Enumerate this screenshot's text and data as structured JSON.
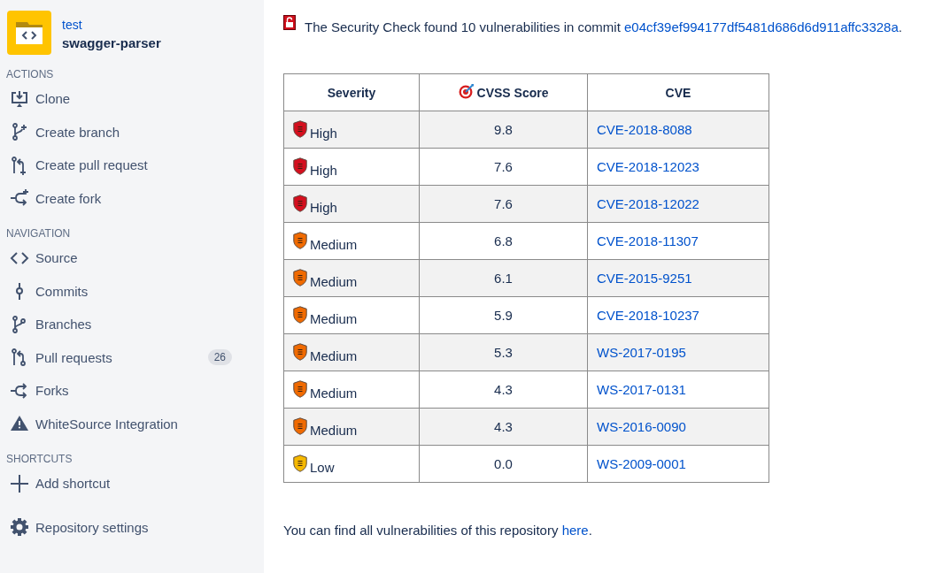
{
  "sidebar": {
    "repository": {
      "workspace": "test",
      "name": "swagger-parser"
    },
    "sections": [
      {
        "heading": "ACTIONS",
        "items": [
          {
            "label": "Clone"
          },
          {
            "label": "Create branch"
          },
          {
            "label": "Create pull request"
          },
          {
            "label": "Create fork"
          }
        ]
      },
      {
        "heading": "NAVIGATION",
        "items": [
          {
            "label": "Source"
          },
          {
            "label": "Commits"
          },
          {
            "label": "Branches"
          },
          {
            "label": "Pull requests",
            "badge": "26"
          },
          {
            "label": "Forks"
          },
          {
            "label": "WhiteSource Integration"
          }
        ]
      },
      {
        "heading": "SHORTCUTS",
        "items": [
          {
            "label": "Add shortcut"
          }
        ]
      }
    ],
    "settings": "Repository settings"
  },
  "summary": {
    "text": "The Security Check found 10 vulnerabilities in commit ",
    "commit": "e04cf39ef994177df5481d686d6d911affc3328a",
    "end": "."
  },
  "table": {
    "columns": [
      "Severity",
      "CVSS Score",
      "CVE"
    ],
    "rows": [
      {
        "severity": "High",
        "color": "#d40f1e",
        "score": "9.8",
        "cve": "CVE-2018-8088"
      },
      {
        "severity": "High",
        "color": "#d40f1e",
        "score": "7.6",
        "cve": "CVE-2018-12023"
      },
      {
        "severity": "High",
        "color": "#d40f1e",
        "score": "7.6",
        "cve": "CVE-2018-12022"
      },
      {
        "severity": "Medium",
        "color": "#f06a00",
        "score": "6.8",
        "cve": "CVE-2018-11307"
      },
      {
        "severity": "Medium",
        "color": "#f06a00",
        "score": "6.1",
        "cve": "CVE-2015-9251"
      },
      {
        "severity": "Medium",
        "color": "#f06a00",
        "score": "5.9",
        "cve": "CVE-2018-10237"
      },
      {
        "severity": "Medium",
        "color": "#f06a00",
        "score": "5.3",
        "cve": "WS-2017-0195"
      },
      {
        "severity": "Medium",
        "color": "#f06a00",
        "score": "4.3",
        "cve": "WS-2017-0131"
      },
      {
        "severity": "Medium",
        "color": "#f06a00",
        "score": "4.3",
        "cve": "WS-2016-0090"
      },
      {
        "severity": "Low",
        "color": "#f5b800",
        "score": "0.0",
        "cve": "WS-2009-0001"
      }
    ]
  },
  "footer_note": {
    "text": "You can find all vulnerabilities of this repository ",
    "link": "here",
    "end": "."
  }
}
